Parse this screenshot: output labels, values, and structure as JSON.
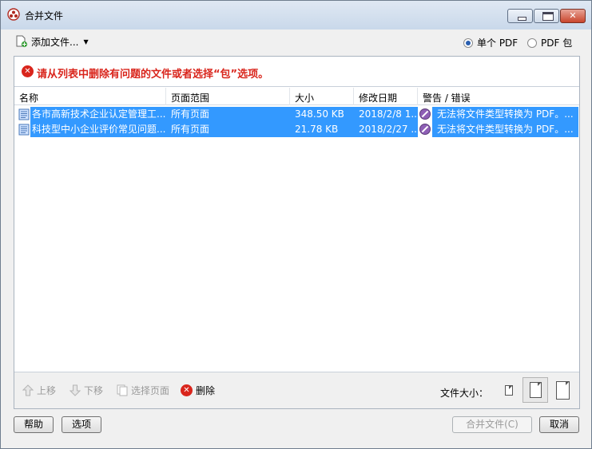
{
  "window": {
    "title": "合并文件",
    "close_glyph": "✕"
  },
  "toolbar": {
    "add_files_label": "添加文件...",
    "dropdown_caret": "▼",
    "options": [
      {
        "label": "单个 PDF",
        "checked": true
      },
      {
        "label": "PDF 包",
        "checked": false
      }
    ]
  },
  "error": {
    "icon_glyph": "✕",
    "message": "请从列表中删除有问题的文件或者选择“包”选项。"
  },
  "table": {
    "columns": [
      "名称",
      "页面范围",
      "大小",
      "修改日期",
      "警告 / 错误"
    ],
    "rows": [
      {
        "name": "各市高新技术企业认定管理工...",
        "page_range": "所有页面",
        "size": "348.50 KB",
        "modified": "2018/2/8 1...",
        "warning": "无法将文件类型转换为 PDF。..."
      },
      {
        "name": "科技型中小企业评价常见问题...",
        "page_range": "所有页面",
        "size": "21.78 KB",
        "modified": "2018/2/27 ...",
        "warning": "无法将文件类型转换为 PDF。..."
      }
    ]
  },
  "bottom_toolbar": {
    "move_up": "上移",
    "move_down": "下移",
    "choose_pages": "选择页面",
    "delete": "删除",
    "delete_glyph": "✕",
    "file_size_label": "文件大小："
  },
  "footer": {
    "help": "帮助",
    "options": "选项",
    "merge": "合并文件(C)",
    "cancel": "取消"
  },
  "colors": {
    "selection": "#3399ff",
    "error": "#d9251c"
  }
}
